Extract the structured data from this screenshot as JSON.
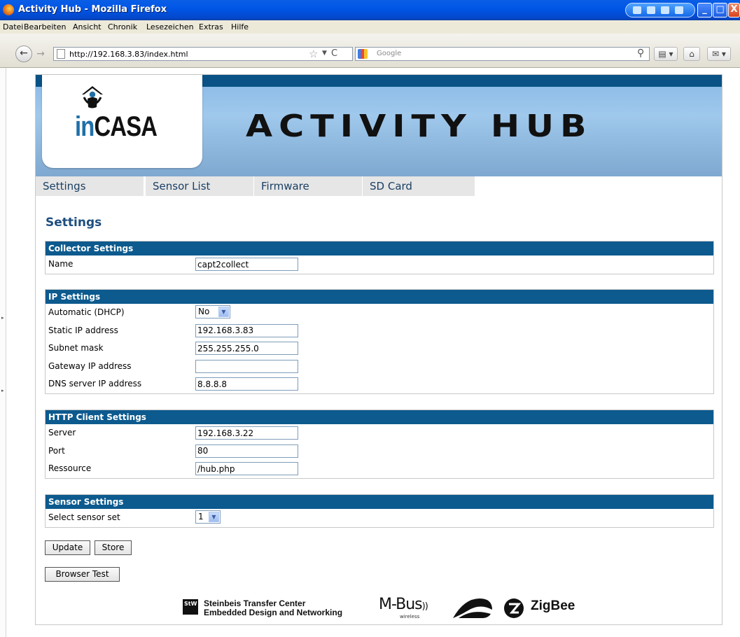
{
  "window": {
    "title": "Activity Hub - Mozilla Firefox",
    "minimize_glyph": "_",
    "maximize_glyph": "□",
    "close_glyph": "X"
  },
  "menubar": {
    "items": [
      "Datei",
      "Bearbeiten",
      "Ansicht",
      "Chronik",
      "Lesezeichen",
      "Extras",
      "Hilfe"
    ]
  },
  "navbar": {
    "back_glyph": "←",
    "forward_glyph": "→",
    "url": "http://192.168.3.83/index.html",
    "search_placeholder": "Google",
    "home_glyph": "⌂"
  },
  "brand": {
    "logo_in": "in",
    "logo_casa": "CASA",
    "hub_title": "ACTIVITY HUB"
  },
  "tabs": [
    "Settings",
    "Sensor List",
    "Firmware",
    "SD Card"
  ],
  "page_title": "Settings",
  "sections": {
    "collector": {
      "title": "Collector Settings",
      "name_label": "Name",
      "name_value": "capt2collect"
    },
    "ip": {
      "title": "IP Settings",
      "dhcp_label": "Automatic (DHCP)",
      "dhcp_value": "No",
      "static_ip_label": "Static IP address",
      "static_ip_value": "192.168.3.83",
      "subnet_label": "Subnet mask",
      "subnet_value": "255.255.255.0",
      "gateway_label": "Gateway IP address",
      "gateway_value": "",
      "dns_label": "DNS server IP address",
      "dns_value": "8.8.8.8"
    },
    "http": {
      "title": "HTTP Client Settings",
      "server_label": "Server",
      "server_value": "192.168.3.22",
      "port_label": "Port",
      "port_value": "80",
      "resource_label": "Ressource",
      "resource_value": "/hub.php"
    },
    "sensor": {
      "title": "Sensor Settings",
      "set_label": "Select sensor set",
      "set_value": "1"
    }
  },
  "buttons": {
    "update": "Update",
    "store": "Store",
    "browser_test": "Browser Test"
  },
  "footer": {
    "stw_line1": "Steinbeis Transfer Center",
    "stw_line2": "Embedded Design and Networking",
    "stw_box": "StW",
    "mbus": "M-Bus",
    "mbus_sub": "wireless",
    "zigbee": "ZigBee"
  },
  "colors": {
    "header_bar": "#0a5286",
    "section_head": "#0c5a8e",
    "title_blue": "#1d4e7f"
  }
}
